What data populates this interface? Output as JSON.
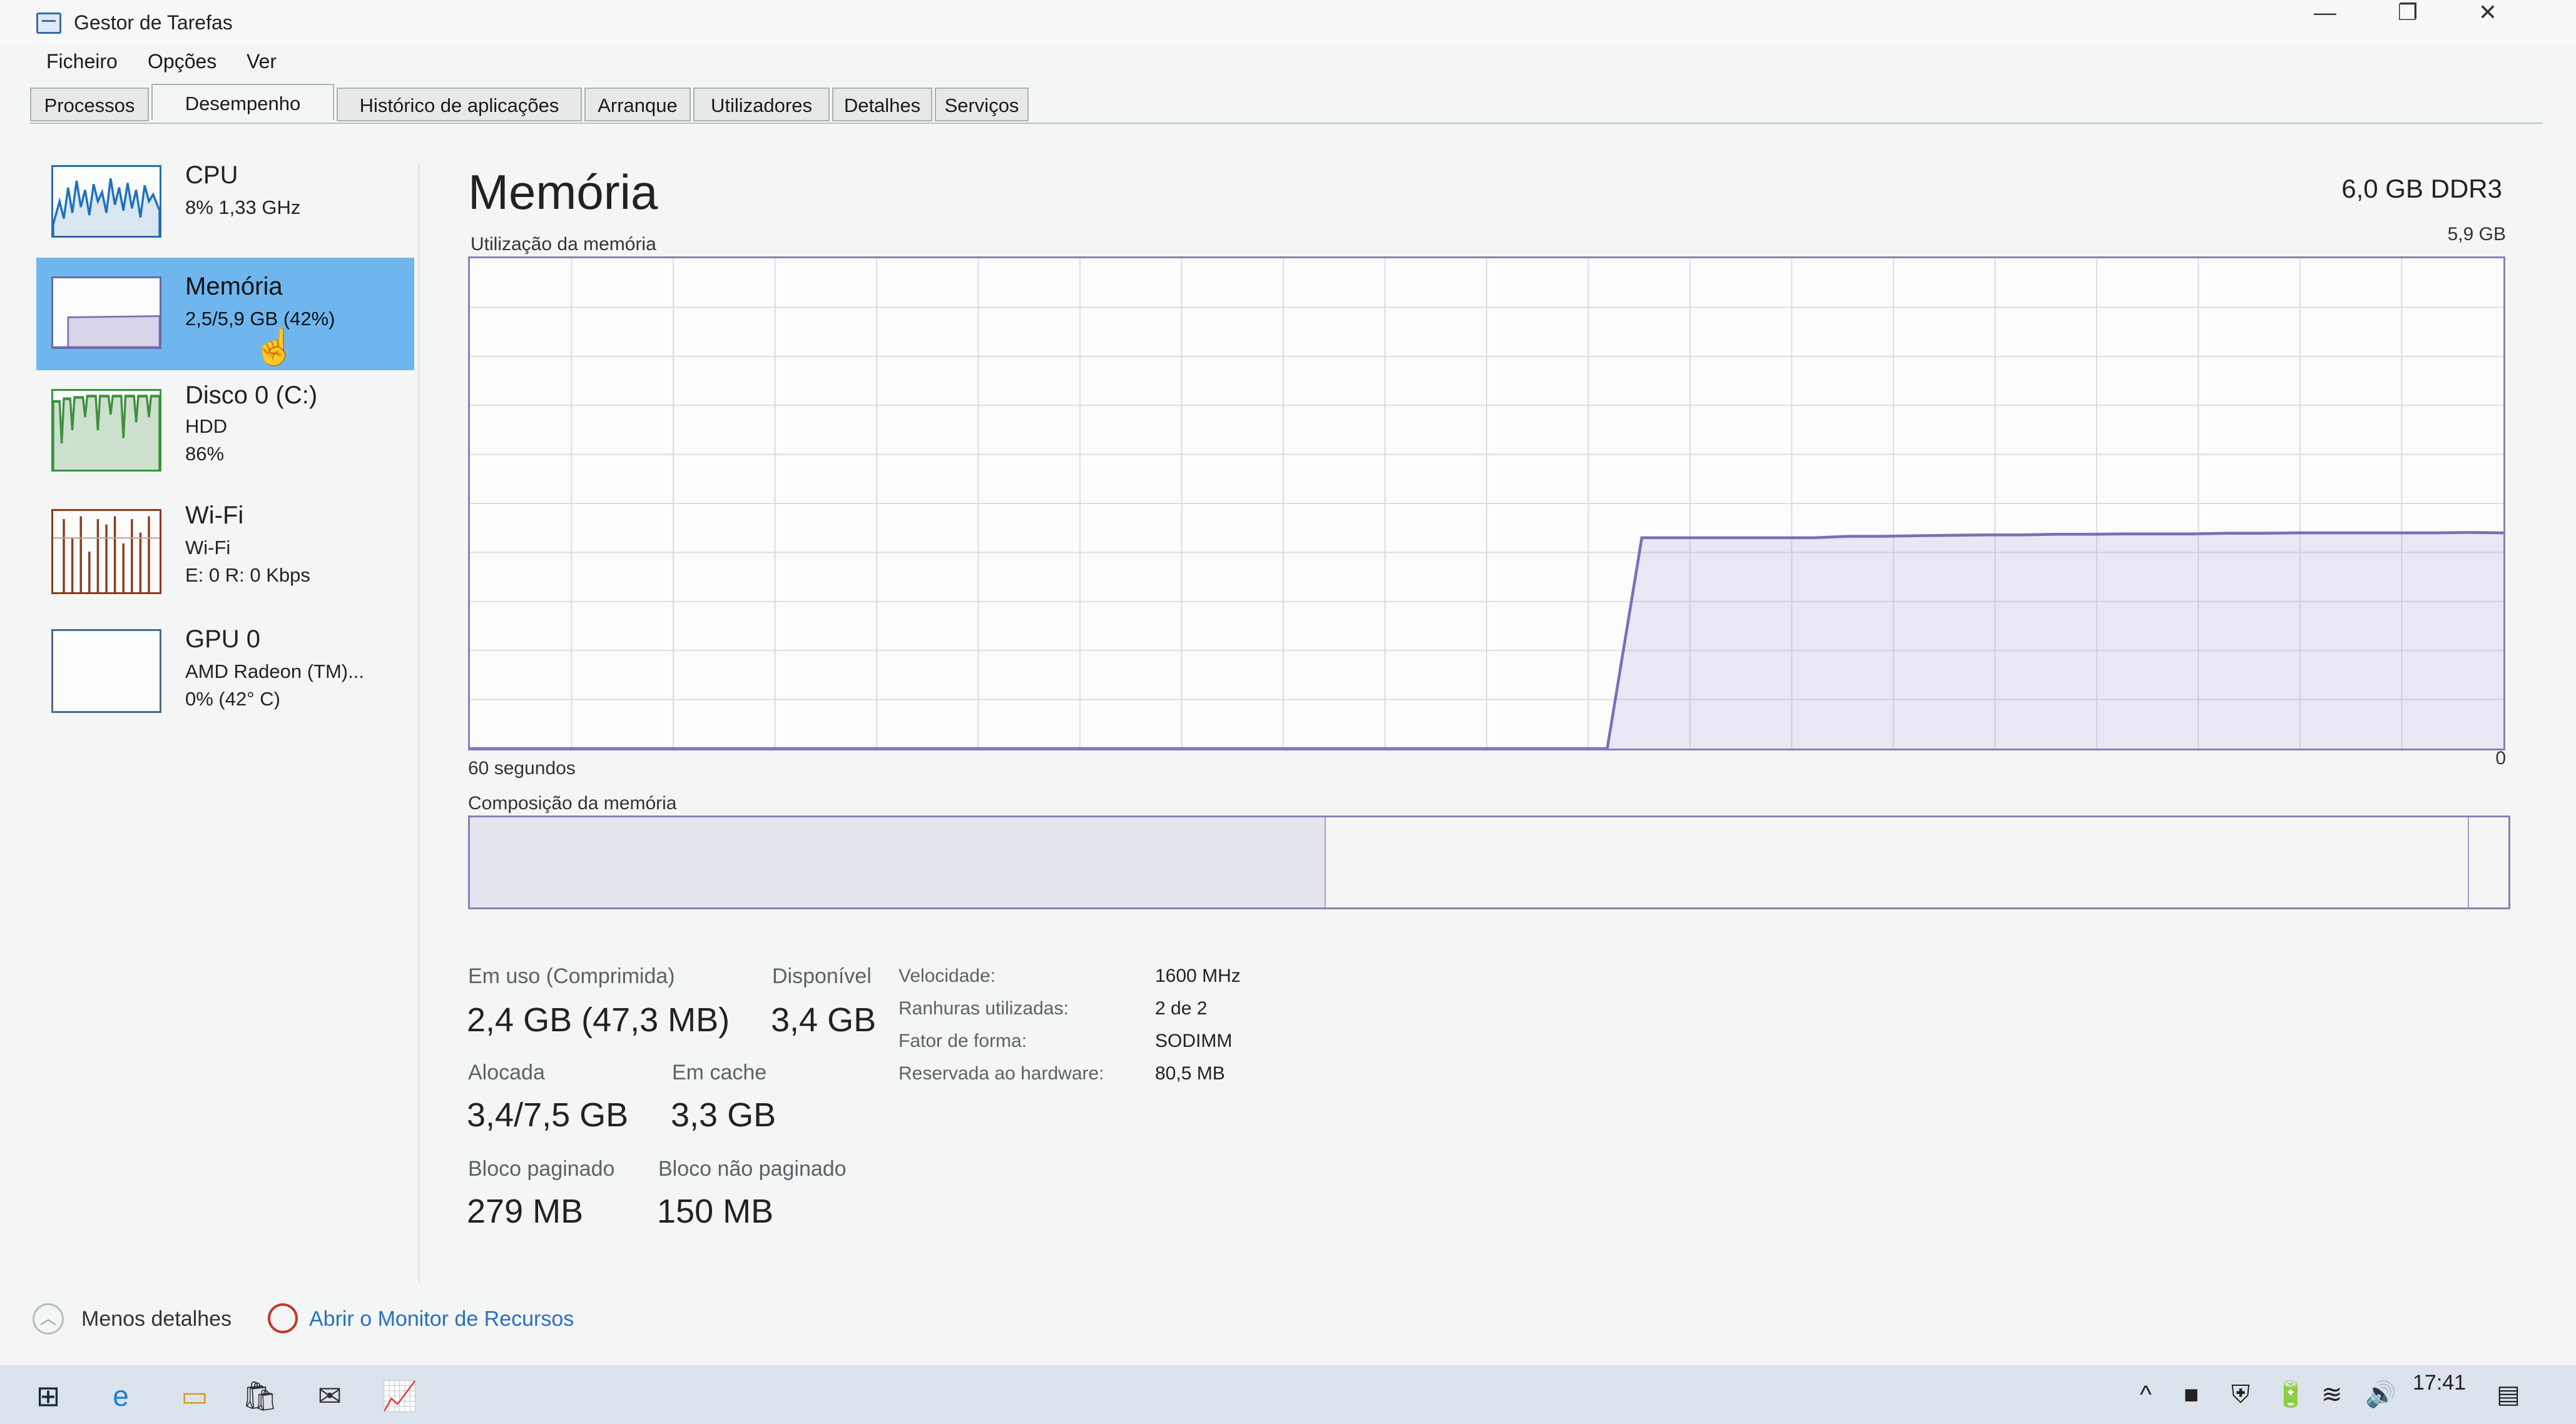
{
  "window": {
    "title": "Gestor de Tarefas",
    "controls": {
      "minimize": "—",
      "restore": "❐",
      "close": "✕"
    }
  },
  "menu": [
    "Ficheiro",
    "Opções",
    "Ver"
  ],
  "tabs": [
    "Processos",
    "Desempenho",
    "Histórico de aplicações",
    "Arranque",
    "Utilizadores",
    "Detalhes",
    "Serviços"
  ],
  "active_tab": "Desempenho",
  "sidebar": [
    {
      "name": "CPU",
      "lines": [
        "8% 1,33 GHz"
      ],
      "graph_color": "#1f6fbf"
    },
    {
      "name": "Memória",
      "lines": [
        "2,5/5,9 GB (42%)"
      ],
      "graph_color": "#7a6fb8",
      "selected": true,
      "usage_fraction": 0.42
    },
    {
      "name": "Disco 0 (C:)",
      "lines": [
        "HDD",
        "86%"
      ],
      "graph_color": "#3f8f3f"
    },
    {
      "name": "Wi-Fi",
      "lines": [
        "Wi-Fi",
        "E: 0 R: 0 Kbps"
      ],
      "graph_color": "#8a3a1a"
    },
    {
      "name": "GPU 0",
      "lines": [
        "AMD Radeon (TM)...",
        "0% (42° C)"
      ],
      "graph_color": "#1f6fbf"
    }
  ],
  "memory": {
    "title": "Memória",
    "spec": "6,0 GB DDR3",
    "graph_label": "Utilização da memória",
    "graph_max": "5,9 GB",
    "graph_time": "60 segundos",
    "graph_min": "0",
    "composition_label": "Composição da memória",
    "composition": {
      "in_use_fraction": 0.42,
      "standby_end_fraction": 0.98
    },
    "usage_history": [
      0,
      0,
      0,
      0,
      0,
      0,
      0,
      0,
      0,
      0,
      0,
      0,
      0,
      0,
      0,
      0,
      0,
      0,
      0,
      0,
      0,
      0,
      0,
      0,
      0,
      0,
      0,
      0,
      0,
      0,
      0,
      0,
      0,
      0,
      0.43,
      0.43,
      0.43,
      0.43,
      0.43,
      0.43,
      0.433,
      0.433,
      0.434,
      0.435,
      0.436,
      0.436,
      0.437,
      0.437,
      0.438,
      0.438,
      0.438,
      0.439,
      0.439,
      0.44,
      0.44,
      0.44,
      0.44,
      0.44,
      0.441,
      0.44
    ],
    "stats": [
      {
        "label": "Em uso (Comprimida)",
        "value": "2,4 GB (47,3 MB)"
      },
      {
        "label": "Disponível",
        "value": "3,4 GB"
      },
      {
        "label": "Alocada",
        "value": "3,4/7,5 GB"
      },
      {
        "label": "Em cache",
        "value": "3,3 GB"
      },
      {
        "label": "Bloco paginado",
        "value": "279 MB"
      },
      {
        "label": "Bloco não paginado",
        "value": "150 MB"
      }
    ],
    "specs": [
      {
        "label": "Velocidade:",
        "value": "1600 MHz"
      },
      {
        "label": "Ranhuras utilizadas:",
        "value": "2 de 2"
      },
      {
        "label": "Fator de forma:",
        "value": "SODIMM"
      },
      {
        "label": "Reservada ao hardware:",
        "value": "80,5 MB"
      }
    ]
  },
  "footer": {
    "less_details": "Menos detalhes",
    "resource_monitor": "Abrir o Monitor de Recursos"
  },
  "taskbar": {
    "icons": [
      "windows-start-icon",
      "edge-icon",
      "file-explorer-icon",
      "store-icon",
      "mail-icon",
      "task-manager-icon"
    ],
    "tray": {
      "chevron": "^",
      "time": "17:41",
      "notification": "▤"
    }
  }
}
